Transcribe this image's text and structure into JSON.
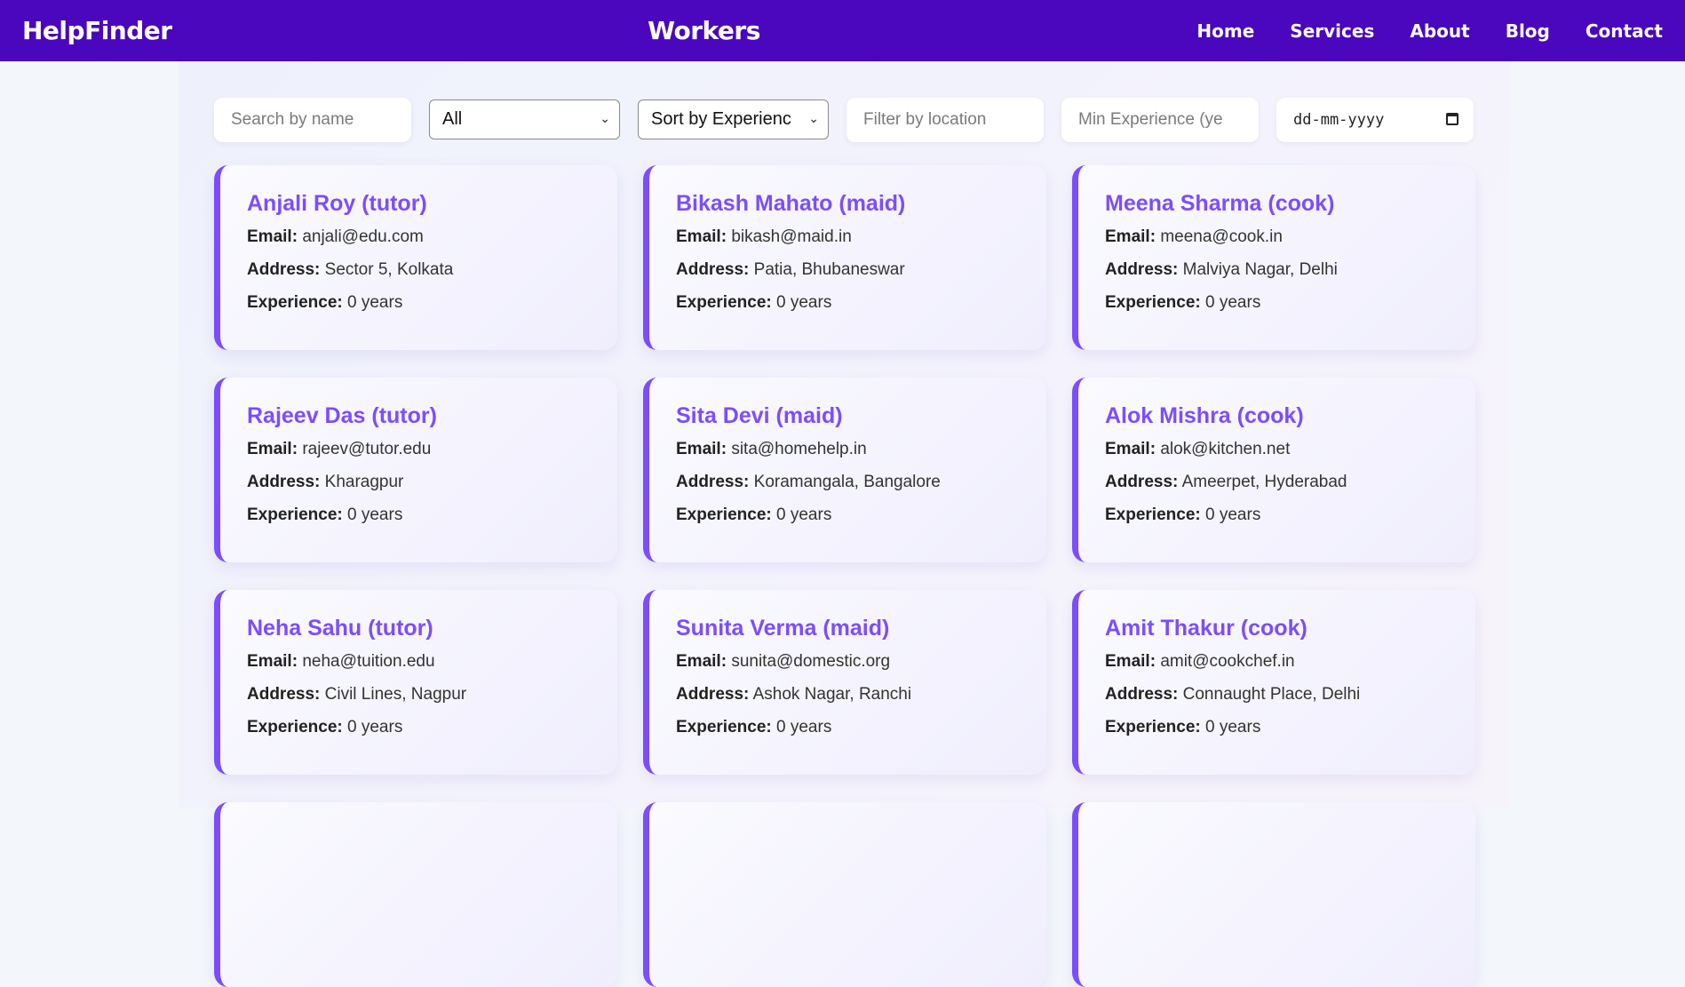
{
  "nav": {
    "brand": "HelpFinder",
    "title": "Workers",
    "links": [
      "Home",
      "Services",
      "About",
      "Blog",
      "Contact"
    ]
  },
  "filters": {
    "search_placeholder": "Search by name",
    "category_selected": "All",
    "sort_selected": "Sort by Experienc",
    "location_placeholder": "Filter by location",
    "min_experience_placeholder": "Min Experience (ye",
    "date_placeholder": "dd-mm-yyyy"
  },
  "labels": {
    "email": "Email:",
    "address": "Address:",
    "experience": "Experience:"
  },
  "workers": [
    {
      "title": "Anjali Roy (tutor)",
      "email": "anjali@edu.com",
      "address": "Sector 5, Kolkata",
      "experience": "0 years"
    },
    {
      "title": "Bikash Mahato (maid)",
      "email": "bikash@maid.in",
      "address": "Patia, Bhubaneswar",
      "experience": "0 years"
    },
    {
      "title": "Meena Sharma (cook)",
      "email": "meena@cook.in",
      "address": "Malviya Nagar, Delhi",
      "experience": "0 years"
    },
    {
      "title": "Rajeev Das (tutor)",
      "email": "rajeev@tutor.edu",
      "address": "Kharagpur",
      "experience": "0 years"
    },
    {
      "title": "Sita Devi (maid)",
      "email": "sita@homehelp.in",
      "address": "Koramangala, Bangalore",
      "experience": "0 years"
    },
    {
      "title": "Alok Mishra (cook)",
      "email": "alok@kitchen.net",
      "address": "Ameerpet, Hyderabad",
      "experience": "0 years"
    },
    {
      "title": "Neha Sahu (tutor)",
      "email": "neha@tuition.edu",
      "address": "Civil Lines, Nagpur",
      "experience": "0 years"
    },
    {
      "title": "Sunita Verma (maid)",
      "email": "sunita@domestic.org",
      "address": "Ashok Nagar, Ranchi",
      "experience": "0 years"
    },
    {
      "title": "Amit Thakur (cook)",
      "email": "amit@cookchef.in",
      "address": "Connaught Place, Delhi",
      "experience": "0 years"
    },
    {
      "title": "",
      "email": "",
      "address": "",
      "experience": ""
    },
    {
      "title": "",
      "email": "",
      "address": "",
      "experience": ""
    },
    {
      "title": "",
      "email": "",
      "address": "",
      "experience": ""
    }
  ]
}
